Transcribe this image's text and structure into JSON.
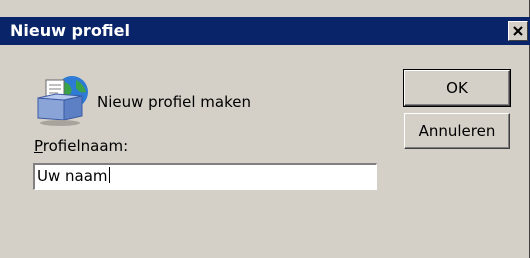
{
  "window": {
    "title": "Nieuw profiel"
  },
  "dialog": {
    "heading": "Nieuw profiel maken",
    "field_label_accel": "P",
    "field_label_rest": "rofielnaam:",
    "input_value": "Uw naam"
  },
  "buttons": {
    "ok": "OK",
    "cancel": "Annuleren"
  },
  "icons": {
    "close": "close-icon",
    "app": "new-profile-icon"
  },
  "colors": {
    "titlebar": "#0a246a",
    "face": "#d4d0c8"
  }
}
